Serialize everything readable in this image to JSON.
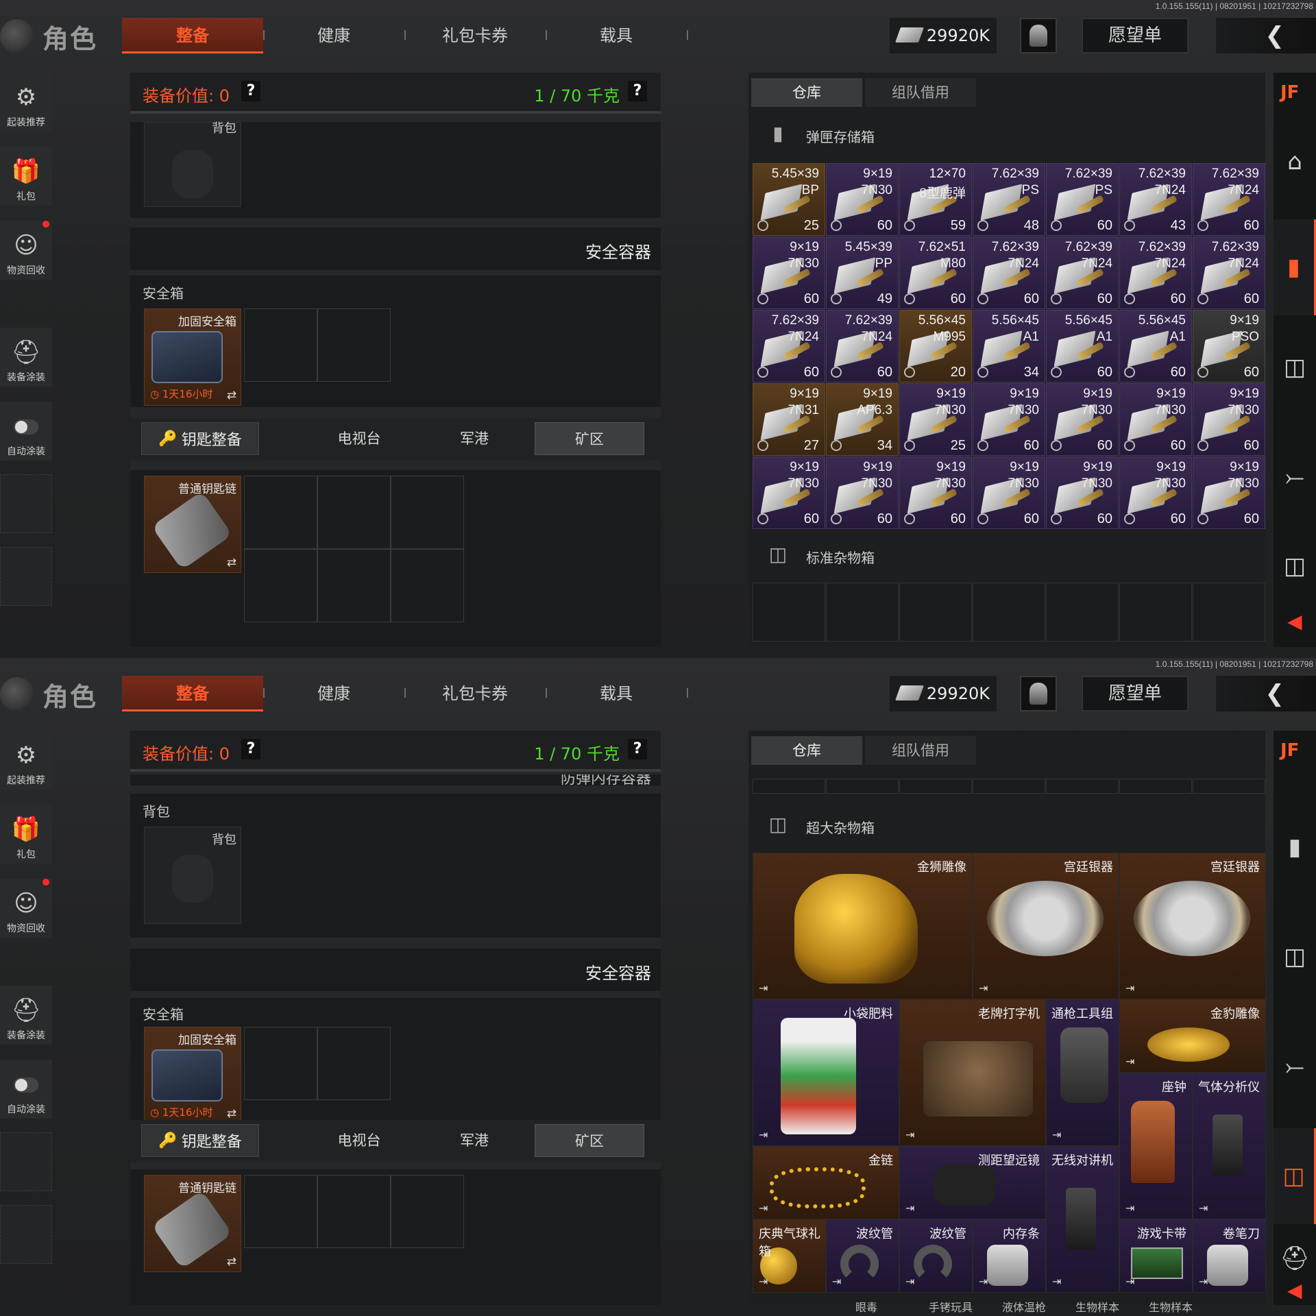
{
  "version": "1.0.155.155(11) | 08201951 | 10217232798",
  "header": {
    "title": "角色",
    "tabs": [
      "整备",
      "健康",
      "礼包卡券",
      "载具"
    ],
    "money": "29920K",
    "wishlist": "愿望单",
    "back_icon": "chevron-left-icon"
  },
  "sidebar": {
    "items": [
      {
        "label": "起装推荐",
        "icon": "loadout-icon"
      },
      {
        "label": "礼包",
        "icon": "gift-icon"
      },
      {
        "label": "物资回收",
        "icon": "recycle-icon"
      },
      {
        "label": "装备涂装",
        "icon": "helmet-icon"
      },
      {
        "label": "自动涂装",
        "icon": "toggle-icon"
      }
    ]
  },
  "equipment": {
    "value_label": "装备价值: 0",
    "weight_label": "1 / 70 千克",
    "help": "?",
    "backpack_label": "背包",
    "safe_container_title": "安全容器",
    "safe_box_label": "安全箱",
    "safe_item_name": "加固安全箱",
    "safe_item_timer": "1天16小时",
    "key_button": "钥匙整备",
    "key_tabs": [
      "电视台",
      "军港",
      "矿区"
    ],
    "key_item_name": "普通钥匙链",
    "swap": "⇄",
    "panel2_top_cut": "防弹内存容器"
  },
  "warehouse": {
    "tabs": [
      "仓库",
      "组队借用"
    ],
    "ammo_box_title": "弹匣存储箱",
    "misc_box_title": "标准杂物箱",
    "xl_box_title": "超大杂物箱",
    "ammo": [
      {
        "cal": "5.45×39",
        "typ": "BP",
        "cnt": "25",
        "tone": "gold"
      },
      {
        "cal": "9×19",
        "typ": "7N30",
        "cnt": "60",
        "tone": "purple"
      },
      {
        "cal": "12×70",
        "typ": "8型鹿弹",
        "cnt": "59",
        "tone": "purple"
      },
      {
        "cal": "7.62×39",
        "typ": "PS",
        "cnt": "48",
        "tone": "purple"
      },
      {
        "cal": "7.62×39",
        "typ": "PS",
        "cnt": "60",
        "tone": "purple"
      },
      {
        "cal": "7.62×39",
        "typ": "7N24",
        "cnt": "43",
        "tone": "purple"
      },
      {
        "cal": "7.62×39",
        "typ": "7N24",
        "cnt": "60",
        "tone": "purple"
      },
      {
        "cal": "9×19",
        "typ": "7N30",
        "cnt": "60",
        "tone": "purple"
      },
      {
        "cal": "5.45×39",
        "typ": "PP",
        "cnt": "49",
        "tone": "purple"
      },
      {
        "cal": "7.62×51",
        "typ": "M80",
        "cnt": "60",
        "tone": "purple"
      },
      {
        "cal": "7.62×39",
        "typ": "7N24",
        "cnt": "60",
        "tone": "purple"
      },
      {
        "cal": "7.62×39",
        "typ": "7N24",
        "cnt": "60",
        "tone": "purple"
      },
      {
        "cal": "7.62×39",
        "typ": "7N24",
        "cnt": "60",
        "tone": "purple"
      },
      {
        "cal": "7.62×39",
        "typ": "7N24",
        "cnt": "60",
        "tone": "purple"
      },
      {
        "cal": "7.62×39",
        "typ": "7N24",
        "cnt": "60",
        "tone": "purple"
      },
      {
        "cal": "7.62×39",
        "typ": "7N24",
        "cnt": "60",
        "tone": "purple"
      },
      {
        "cal": "5.56×45",
        "typ": "M995",
        "cnt": "20",
        "tone": "gold"
      },
      {
        "cal": "5.56×45",
        "typ": "A1",
        "cnt": "34",
        "tone": "purple"
      },
      {
        "cal": "5.56×45",
        "typ": "A1",
        "cnt": "60",
        "tone": "purple"
      },
      {
        "cal": "5.56×45",
        "typ": "A1",
        "cnt": "60",
        "tone": "purple"
      },
      {
        "cal": "9×19",
        "typ": "PSO",
        "cnt": "60",
        "tone": "gray"
      },
      {
        "cal": "9×19",
        "typ": "7N31",
        "cnt": "27",
        "tone": "gold"
      },
      {
        "cal": "9×19",
        "typ": "AP6.3",
        "cnt": "34",
        "tone": "gold"
      },
      {
        "cal": "9×19",
        "typ": "7N30",
        "cnt": "25",
        "tone": "purple"
      },
      {
        "cal": "9×19",
        "typ": "7N30",
        "cnt": "60",
        "tone": "purple"
      },
      {
        "cal": "9×19",
        "typ": "7N30",
        "cnt": "60",
        "tone": "purple"
      },
      {
        "cal": "9×19",
        "typ": "7N30",
        "cnt": "60",
        "tone": "purple"
      },
      {
        "cal": "9×19",
        "typ": "7N30",
        "cnt": "60",
        "tone": "purple"
      },
      {
        "cal": "9×19",
        "typ": "7N30",
        "cnt": "60",
        "tone": "purple"
      },
      {
        "cal": "9×19",
        "typ": "7N30",
        "cnt": "60",
        "tone": "purple"
      },
      {
        "cal": "9×19",
        "typ": "7N30",
        "cnt": "60",
        "tone": "purple"
      },
      {
        "cal": "9×19",
        "typ": "7N30",
        "cnt": "60",
        "tone": "purple"
      },
      {
        "cal": "9×19",
        "typ": "7N30",
        "cnt": "60",
        "tone": "purple"
      },
      {
        "cal": "9×19",
        "typ": "7N30",
        "cnt": "60",
        "tone": "purple"
      },
      {
        "cal": "9×19",
        "typ": "7N30",
        "cnt": "60",
        "tone": "purple"
      }
    ],
    "misc_items": [
      {
        "name": "金狮雕像",
        "tone": "gold"
      },
      {
        "name": "宫廷银器",
        "tone": "gold"
      },
      {
        "name": "宫廷银器",
        "tone": "gold"
      },
      {
        "name": "小袋肥料",
        "tone": "purple"
      },
      {
        "name": "老牌打字机",
        "tone": "gold"
      },
      {
        "name": "通枪工具组",
        "tone": "purple"
      },
      {
        "name": "金豹雕像",
        "tone": "gold"
      },
      {
        "name": "座钟",
        "tone": "purple"
      },
      {
        "name": "气体分析仪",
        "tone": "purple"
      },
      {
        "name": "金链",
        "tone": "gold"
      },
      {
        "name": "测距望远镜",
        "tone": "purple"
      },
      {
        "name": "无线对讲机",
        "tone": "purple"
      },
      {
        "name": "庆典气球礼箱",
        "tone": "gold"
      },
      {
        "name": "波纹管",
        "tone": "purple"
      },
      {
        "name": "波纹管",
        "tone": "purple"
      },
      {
        "name": "内存条",
        "tone": "purple"
      },
      {
        "name": "游戏卡带",
        "tone": "purple"
      },
      {
        "name": "卷笔刀",
        "tone": "purple"
      }
    ],
    "cut_labels": [
      "眼毒",
      "手铐玩具",
      "液体温枪",
      "生物样本",
      "生物样本"
    ]
  },
  "colors": {
    "accent": "#ff5a2a",
    "weight": "#4fdc2a",
    "gold_bg": "#4a2a16",
    "purple_bg": "#2e1f44"
  }
}
